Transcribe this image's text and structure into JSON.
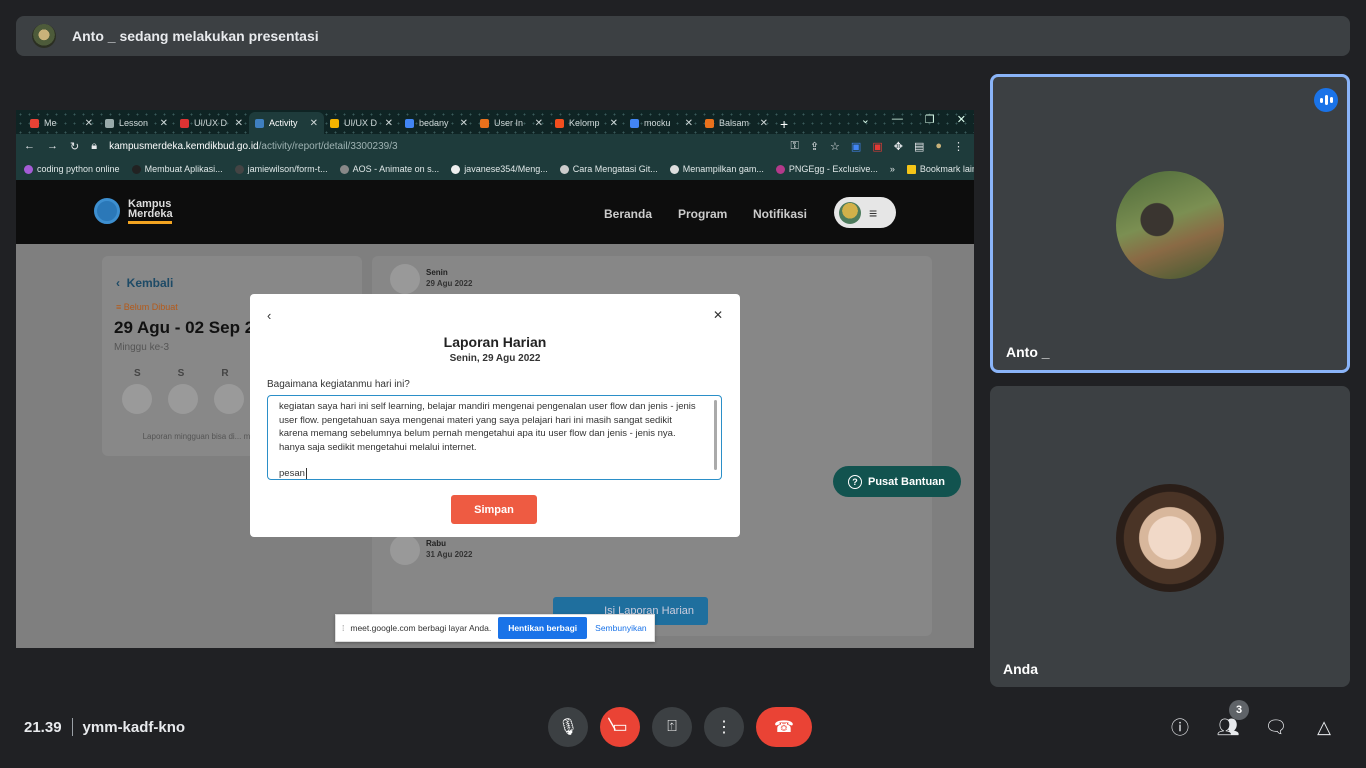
{
  "meet": {
    "presenter_banner": "Anto _ sedang melakukan presentasi",
    "time": "21.39",
    "meeting_code": "ymm-kadf-kno",
    "participants_count": "3",
    "tiles": [
      {
        "name": "Anto _"
      },
      {
        "name": "Anda"
      }
    ],
    "accent_color": "#8ab4f8",
    "end_call_color": "#ea4335"
  },
  "browser": {
    "tabs": [
      {
        "label": "Me",
        "icon": "meet-icon",
        "color": "#e94235"
      },
      {
        "label": "Lesson",
        "icon": "page-icon",
        "color": "#9aa"
      },
      {
        "label": "UI/UX D",
        "icon": "red-logo-icon",
        "color": "#d33"
      },
      {
        "label": "Activity",
        "icon": "lines-icon",
        "color": "#3f7fbf",
        "active": true
      },
      {
        "label": "UI/UX D",
        "icon": "drive-icon",
        "color": "#f5b400"
      },
      {
        "label": "bedany",
        "icon": "google-icon",
        "color": "#4285f4"
      },
      {
        "label": "User In",
        "icon": "spark-icon",
        "color": "#e8711c"
      },
      {
        "label": "Kelomp",
        "icon": "figma-icon",
        "color": "#f24e1e"
      },
      {
        "label": "mocku",
        "icon": "google-icon",
        "color": "#4285f4"
      },
      {
        "label": "Balsam",
        "icon": "spark-icon",
        "color": "#e8711c"
      }
    ],
    "url_host": "kampusmerdeka.kemdikbud.go.id",
    "url_path": "/activity/report/detail/3300239/3",
    "bookmarks": [
      {
        "label": "coding python online",
        "color": "#a45cd6"
      },
      {
        "label": "Membuat Aplikasi...",
        "color": "#222"
      },
      {
        "label": "jamiewilson/form-t...",
        "color": "#444"
      },
      {
        "label": "AOS - Animate on s...",
        "color": "#888"
      },
      {
        "label": "javanese354/Meng...",
        "color": "#eee"
      },
      {
        "label": "Cara Mengatasi Git...",
        "color": "#ccc"
      },
      {
        "label": "Menampilkan gam...",
        "color": "#ddd"
      },
      {
        "label": "PNGEgg - Exclusive...",
        "color": "#b4398a"
      }
    ],
    "bookmarks_more": "»",
    "other_bookmarks": "Bookmark lain"
  },
  "site": {
    "logo_text": "Kampus Merdeka",
    "nav": [
      "Beranda",
      "Program",
      "Notifikasi"
    ],
    "back_label": "Kembali",
    "status": "Belum Dibuat",
    "date_range": "29 Agu - 02 Sep 2",
    "week": "Minggu ke-3",
    "days": [
      "S",
      "S",
      "R"
    ],
    "empty_note": "Laporan mingguan bisa di... mengisi semua lapo...",
    "entries": [
      {
        "day": "Senin",
        "date": "29 Agu 2022"
      },
      {
        "day": "Rabu",
        "date": "31 Agu 2022"
      }
    ],
    "fill_button": "Isi Laporan Harian",
    "help_button": "Pusat Bantuan"
  },
  "modal": {
    "title": "Laporan Harian",
    "subtitle": "Senin, 29 Agu 2022",
    "question": "Bagaimana kegiatanmu hari ini?",
    "text_p1": "kegiatan saya hari ini self learning, belajar mandiri mengenai pengenalan user flow dan jenis - jenis user flow. pengetahuan saya mengenai materi yang saya pelajari hari ini masih sangat sedikit karena memang sebelumnya belum pernah mengetahui apa itu user flow dan jenis - jenis nya. hanya saja sedikit mengetahui melalui internet.",
    "text_p2": "pesan",
    "save_label": "Simpan",
    "save_color": "#ee5b42"
  },
  "share_bar": {
    "message": "meet.google.com berbagi layar Anda.",
    "stop_label": "Hentikan berbagi",
    "hide_label": "Sembunyikan"
  }
}
